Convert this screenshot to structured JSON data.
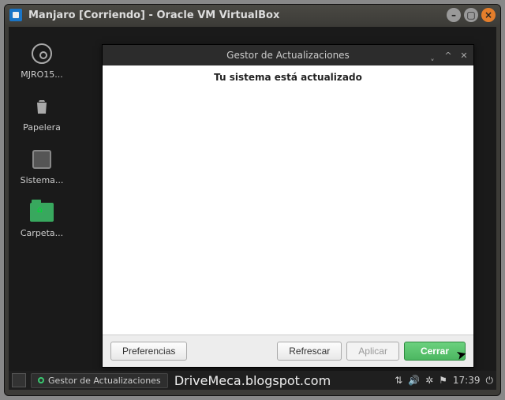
{
  "vbox": {
    "title": "Manjaro [Corriendo] - Oracle VM VirtualBox"
  },
  "desktop": {
    "icons": [
      {
        "label": "MJRO15..."
      },
      {
        "label": "Papelera"
      },
      {
        "label": "Sistema..."
      },
      {
        "label": "Carpeta..."
      }
    ]
  },
  "updater": {
    "title": "Gestor de Actualizaciones",
    "message": "Tu sistema está actualizado",
    "buttons": {
      "preferences": "Preferencias",
      "refresh": "Refrescar",
      "apply": "Aplicar",
      "close": "Cerrar"
    }
  },
  "taskbar": {
    "active_task": "Gestor de Actualizaciones",
    "time": "17:39"
  },
  "watermark": "DriveMeca.blogspot.com"
}
